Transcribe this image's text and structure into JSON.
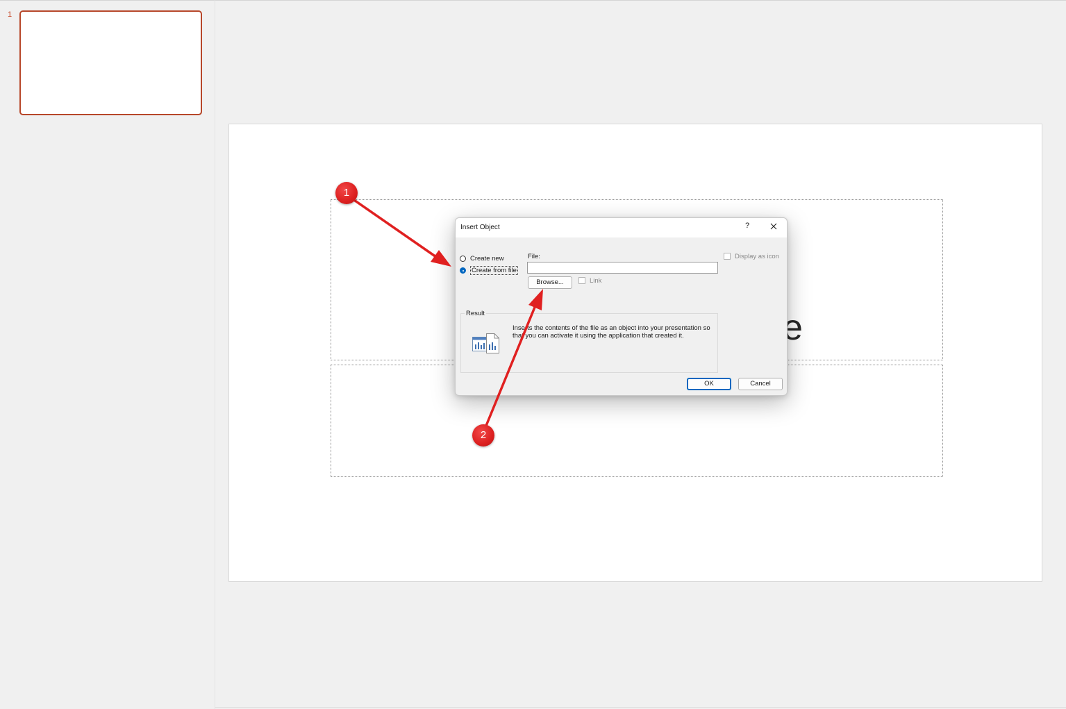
{
  "thumbnails": {
    "items": [
      {
        "number": "1"
      }
    ]
  },
  "slide": {
    "title_visible_fragment": "e"
  },
  "dialog": {
    "title": "Insert Object",
    "help_label": "?",
    "close_icon": "close-icon",
    "options": {
      "create_new": "Create new",
      "create_from_file": "Create from file",
      "selected": "create_from_file"
    },
    "file_label": "File:",
    "file_value": "",
    "browse_label": "Browse...",
    "link_label": "Link",
    "link_checked": false,
    "display_as_icon_label": "Display as icon",
    "display_as_icon_checked": false,
    "result_label": "Result",
    "result_text": "Inserts the contents of the file as an object into your presentation so that you can activate it using the application that created it.",
    "result_icon": "embedded-object-icon",
    "ok_label": "OK",
    "cancel_label": "Cancel"
  },
  "annotations": {
    "markers": [
      {
        "label": "1"
      },
      {
        "label": "2"
      }
    ],
    "color": "#e02020"
  },
  "colors": {
    "accent": "#b7472a",
    "dialog_primary": "#0067c0",
    "annotation": "#e02020"
  }
}
